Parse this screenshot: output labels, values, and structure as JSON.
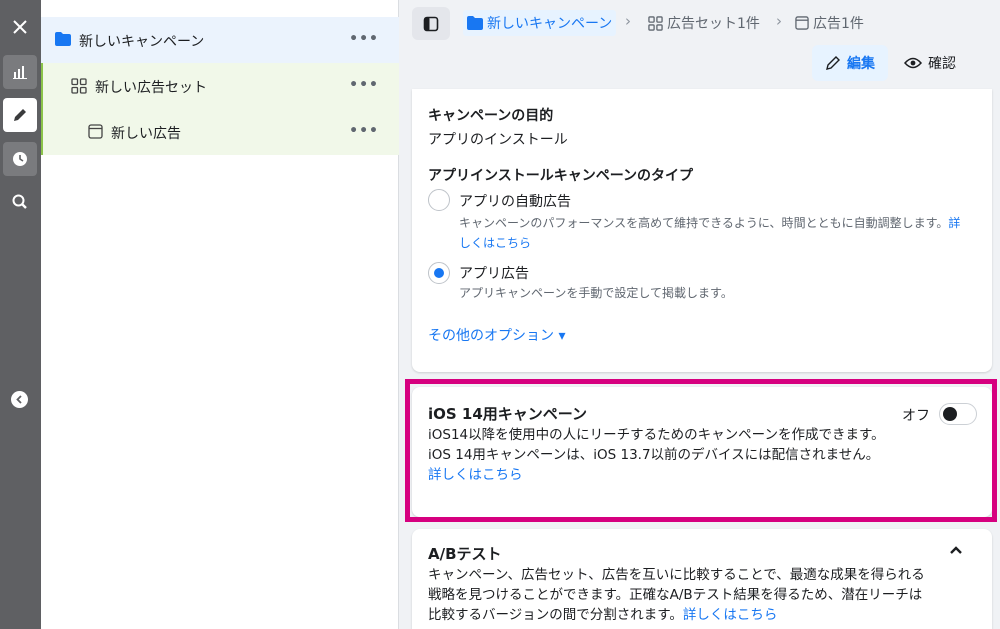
{
  "tree": {
    "campaign": {
      "label": "新しいキャンペーン",
      "more": "•••"
    },
    "adset": {
      "label": "新しい広告セット",
      "more": "•••"
    },
    "ad": {
      "label": "新しい広告",
      "more": "•••"
    }
  },
  "breadcrumb": {
    "campaign": "新しいキャンペーン",
    "adset": "広告セット1件",
    "ad": "広告1件"
  },
  "toolbar": {
    "edit_label": "編集",
    "review_label": "確認"
  },
  "objective": {
    "heading": "キャンペーンの目的",
    "value": "アプリのインストール"
  },
  "campaign_type": {
    "heading": "アプリインストールキャンペーンのタイプ",
    "options": [
      {
        "title": "アプリの自動広告",
        "desc_line1": "キャンペーンのパフォーマンスを高めて維持できるように、時間とともに自動調整します。",
        "link_part1": "詳",
        "link_part2": "しくはこちら",
        "selected": false
      },
      {
        "title": "アプリ広告",
        "desc_line1": "アプリキャンペーンを手動で設定して掲載します。",
        "selected": true
      }
    ],
    "more_options": "その他のオプション ▾"
  },
  "ios14": {
    "title": "iOS 14用キャンペーン",
    "desc": "iOS14以降を使用中の人にリーチするためのキャンペーンを作成できます。iOS 14用キャンペーンは、iOS 13.7以前のデバイスには配信されません。",
    "link": "詳しくはこちら",
    "toggle_label": "オフ",
    "toggle_on": false
  },
  "ab_test": {
    "title": "A/Bテスト",
    "desc": "キャンペーン、広告セット、広告を互いに比較することで、最適な成果を得られる戦略を見つけることができます。正確なA/Bテスト結果を得るため、潜在リーチは比較するバージョンの間で分割されます。",
    "link": "詳しくはこちら"
  },
  "colors": {
    "accent": "#1877f2",
    "highlight": "#d6007f",
    "rail": "#5f6063"
  }
}
